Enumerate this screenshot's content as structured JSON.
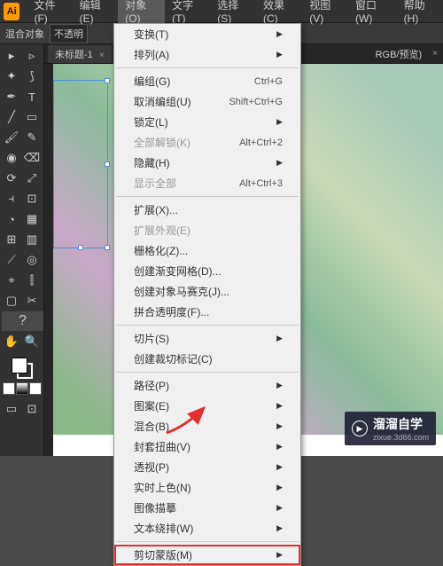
{
  "app_logo": "Ai",
  "menubar": {
    "items": [
      "文件(F)",
      "编辑(E)",
      "对象(O)",
      "文字(T)",
      "选择(S)",
      "效果(C)",
      "视图(V)",
      "窗口(W)",
      "帮助(H)"
    ],
    "active_index": 2
  },
  "controlbar": {
    "label": "混合对象",
    "opacity_label": "不透明"
  },
  "tab": {
    "name": "未标题-1",
    "close": "×",
    "mode": "RGB/预览)"
  },
  "dropdown": {
    "groups": [
      [
        {
          "label": "变换(T)",
          "arrow": true
        },
        {
          "label": "排列(A)",
          "arrow": true
        }
      ],
      [
        {
          "label": "编组(G)",
          "shortcut": "Ctrl+G"
        },
        {
          "label": "取消编组(U)",
          "shortcut": "Shift+Ctrl+G"
        },
        {
          "label": "锁定(L)",
          "arrow": true
        },
        {
          "label": "全部解锁(K)",
          "shortcut": "Alt+Ctrl+2",
          "disabled": true
        },
        {
          "label": "隐藏(H)",
          "arrow": true
        },
        {
          "label": "显示全部",
          "shortcut": "Alt+Ctrl+3",
          "disabled": true
        }
      ],
      [
        {
          "label": "扩展(X)..."
        },
        {
          "label": "扩展外观(E)",
          "disabled": true
        },
        {
          "label": "栅格化(Z)..."
        },
        {
          "label": "创建渐变网格(D)..."
        },
        {
          "label": "创建对象马赛克(J)..."
        },
        {
          "label": "拼合透明度(F)..."
        }
      ],
      [
        {
          "label": "切片(S)",
          "arrow": true
        },
        {
          "label": "创建裁切标记(C)"
        }
      ],
      [
        {
          "label": "路径(P)",
          "arrow": true
        },
        {
          "label": "图案(E)",
          "arrow": true
        },
        {
          "label": "混合(B)",
          "arrow": true
        },
        {
          "label": "封套扭曲(V)",
          "arrow": true
        },
        {
          "label": "透视(P)",
          "arrow": true
        },
        {
          "label": "实时上色(N)",
          "arrow": true
        },
        {
          "label": "图像描摹",
          "arrow": true
        },
        {
          "label": "文本绕排(W)",
          "arrow": true
        }
      ],
      [
        {
          "label": "剪切蒙版(M)",
          "arrow": true,
          "highlighted": true
        }
      ]
    ]
  },
  "watermark": {
    "text": "溜溜自学",
    "sub": "zixue.3d66.com"
  }
}
